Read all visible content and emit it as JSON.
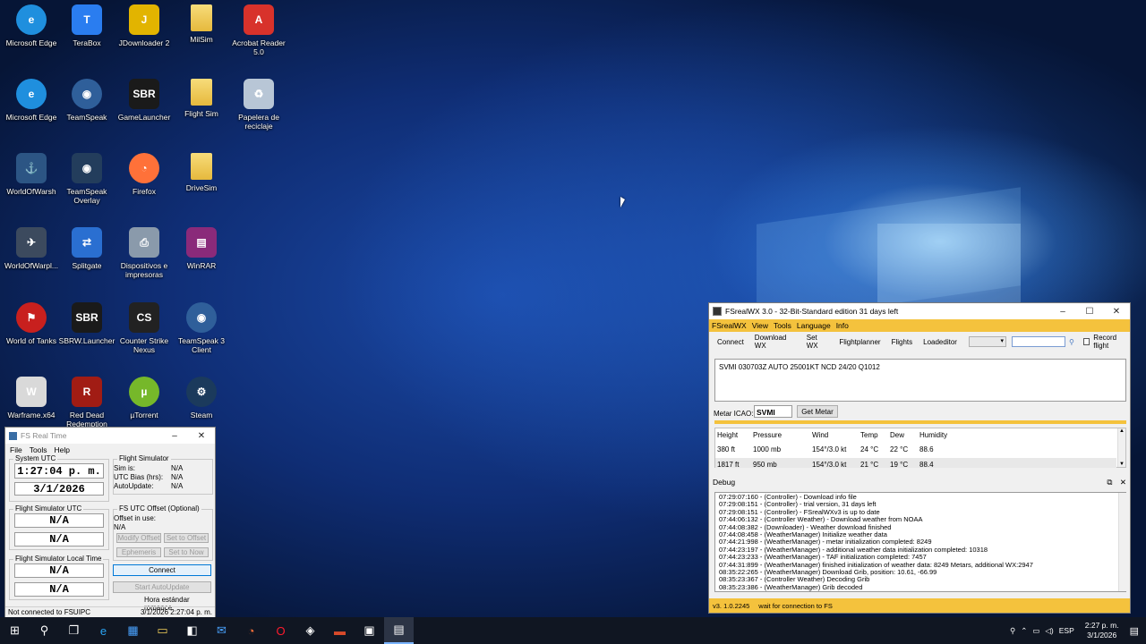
{
  "desktop_icons": [
    {
      "label": "Microsoft Edge",
      "icon": "edge-icon",
      "color": "#1f8fde"
    },
    {
      "label": "TeraBox",
      "icon": "terabox-icon",
      "color": "#2a7df0"
    },
    {
      "label": "JDownloader 2",
      "icon": "jdownloader-icon",
      "color": "#e2b400"
    },
    {
      "label": "MilSim",
      "icon": "folder-icon",
      "color": "#f2cf5a"
    },
    {
      "label": "Acrobat Reader 5.0",
      "icon": "acrobat-icon",
      "color": "#d8322b"
    },
    {
      "label": "Microsoft Edge",
      "icon": "edge-icon",
      "color": "#1f8fde"
    },
    {
      "label": "TeamSpeak",
      "icon": "teamspeak-icon",
      "color": "#2f5f9a"
    },
    {
      "label": "GameLauncher",
      "icon": "sbr-icon",
      "color": "#1a1a1a"
    },
    {
      "label": "Flight Sim",
      "icon": "folder-icon",
      "color": "#f2cf5a"
    },
    {
      "label": "Papelera de reciclaje",
      "icon": "recycle-bin-icon",
      "color": "#b8c6d6"
    },
    {
      "label": "WorldOfWarsh",
      "icon": "warships-icon",
      "color": "#2c5584"
    },
    {
      "label": "TeamSpeak Overlay",
      "icon": "teamspeak-overlay-icon",
      "color": "#233d5c"
    },
    {
      "label": "Firefox",
      "icon": "firefox-icon",
      "color": "#ff7139"
    },
    {
      "label": "DriveSim",
      "icon": "folder-icon",
      "color": "#f2cf5a"
    },
    {
      "label": "WorldOfWarpl...",
      "icon": "warplanes-icon",
      "color": "#3c4a5e"
    },
    {
      "label": "Splitgate",
      "icon": "splitgate-icon",
      "color": "#2a6fd1"
    },
    {
      "label": "Dispositivos e impresoras",
      "icon": "printer-icon",
      "color": "#8a9aab"
    },
    {
      "label": "WinRAR",
      "icon": "winrar-icon",
      "color": "#8a2a7a"
    },
    {
      "label": "World of Tanks",
      "icon": "tanks-icon",
      "color": "#c8201e"
    },
    {
      "label": "SBRW.Launcher",
      "icon": "sbr-icon",
      "color": "#1a1a1a"
    },
    {
      "label": "Counter Strike Nexus",
      "icon": "counter-strike-icon",
      "color": "#222222"
    },
    {
      "label": "TeamSpeak 3 Client",
      "icon": "teamspeak-icon",
      "color": "#2f5f9a"
    },
    {
      "label": "Warframe.x64",
      "icon": "warframe-icon",
      "color": "#d9d9d9"
    },
    {
      "label": "Red Dead Redemption",
      "icon": "rdr-icon",
      "color": "#a11c14"
    },
    {
      "label": "µTorrent",
      "icon": "utorrent-icon",
      "color": "#76b82a"
    },
    {
      "label": "Steam",
      "icon": "steam-icon",
      "color": "#1b3a5c"
    }
  ],
  "fsrt": {
    "title": "FS Real Time",
    "menu": [
      "File",
      "Tools",
      "Help"
    ],
    "system_utc_title": "System UTC",
    "time": "1:27:04 p. m.",
    "date": "3/1/2026",
    "flight_sim_title": "Flight Simulator",
    "sim_is_label": "Sim is:",
    "sim_is_value": "N/A",
    "utc_bias_label": "UTC Bias (hrs):",
    "utc_bias_value": "N/A",
    "autoupdate_label": "AutoUpdate:",
    "autoupdate_value": "N/A",
    "fs_utc_title": "Flight Simulator UTC",
    "fs_utc_time": "N/A",
    "fs_utc_date": "N/A",
    "offset_title": "FS UTC Offset (Optional)",
    "offset_in_use_label": "Offset in use:",
    "offset_in_use_value": "N/A",
    "modify_offset": "Modify Offset",
    "set_to_offset": "Set to Offset",
    "ephemeris": "Ephemeris",
    "set_to_now": "Set to Now",
    "fs_local_title": "Flight Simulator Local Time",
    "fs_local_time": "N/A",
    "fs_local_date": "N/A",
    "connect": "Connect",
    "start_autoupdate": "Start AutoUpdate",
    "timezone": "Hora estándar romance",
    "status_left": "Not connected to FSUIPC",
    "status_right": "3/1/2026 2:27:04 p. m."
  },
  "fswx": {
    "title": "FSrealWX 3.0 - 32-Bit-Standard edition 31 days left",
    "menu": [
      "FSrealWX",
      "View",
      "Tools",
      "Language",
      "Info"
    ],
    "toolbar": [
      "Connect",
      "Download WX",
      "Set WX",
      "Flightplanner",
      "Flights",
      "Loadeditor"
    ],
    "record_flight": "Record flight",
    "metar_text": "SVMI 030703Z AUTO 25001KT NCD 24/20 Q1012",
    "metar_icao_label": "Metar ICAO:",
    "metar_icao_value": "SVMI",
    "get_metar": "Get Metar",
    "columns": [
      "Height",
      "Pressure",
      "Wind",
      "Temp",
      "Dew",
      "Humidity"
    ],
    "rows": [
      [
        "380 ft",
        "1000 mb",
        "154°/3.0 kt",
        "24 °C",
        "22 °C",
        "88.6"
      ],
      [
        "1817 ft",
        "950 mb",
        "154°/3.0 kt",
        "21 °C",
        "19 °C",
        "88.4"
      ]
    ],
    "debug_title": "Debug",
    "log": [
      "07:29:07:160 - (Controller) - Download info file",
      "07:29:08:151 - (Controller) - trial version, 31 days left",
      "07:29:08:151 - (Controller) - FSrealWXv3 is up to date",
      "07:44:06:132 - (Controller Weather) - Download weather from NOAA",
      "07:44:08:382 - (Downloader) - Weather download finished",
      "07:44:08:458 - (WeatherManager) Initialize weather data",
      "07:44:21:998 - (WeatherManager) - metar initialization completed: 8249",
      "07:44:23:197 - (WeatherManager) - additional weather data initialization completed: 10318",
      "07:44:23:233 - (WeatherManager) - TAF initialization completed: 7457",
      "07:44:31:899 - (WeatherManager) finished initialization of weather data: 8249 Metars, additional WX:2947",
      "08:35:22:265 - (WeatherManager) Download Grib, position: 10.61, -66.99",
      "08:35:23:367 - (Controller Weather) Decoding Grib",
      "08:35:23:386 - (WeatherManager) Grib decoded"
    ],
    "version": "v3. 1.0.2245",
    "status": "wait for connection to FS"
  },
  "taskbar": {
    "items": [
      "start-icon",
      "search-icon",
      "task-view-icon",
      "edge-icon",
      "store-icon",
      "file-explorer-icon",
      "shopping-bag-icon",
      "mail-icon",
      "firefox-icon",
      "opera-icon",
      "app-icon",
      "app-red-icon",
      "app-map-icon",
      "fsrealwx-icon"
    ],
    "language": "ESP",
    "time": "2:27 p. m.",
    "date": "3/1/2026"
  }
}
